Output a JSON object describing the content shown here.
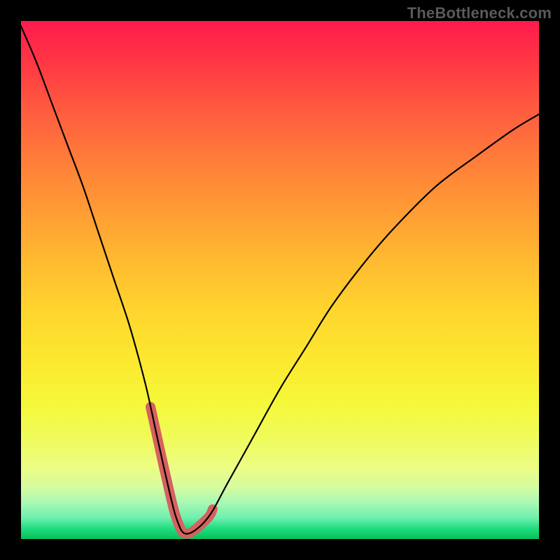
{
  "watermark": "TheBottleneck.com",
  "chart_data": {
    "type": "line",
    "title": "",
    "xlabel": "",
    "ylabel": "",
    "xlim": [
      0,
      100
    ],
    "ylim": [
      0,
      100
    ],
    "background_gradient": {
      "top": "#ff1a4d",
      "bottom": "#06c25a",
      "meaning": "red (high/bottleneck) to green (low/no bottleneck)"
    },
    "series": [
      {
        "name": "bottleneck-curve",
        "x": [
          0,
          3,
          6,
          9,
          12,
          15,
          18,
          21,
          24,
          26,
          28,
          30,
          32,
          36,
          40,
          45,
          50,
          55,
          60,
          66,
          72,
          80,
          88,
          95,
          100
        ],
        "y": [
          99,
          92,
          84,
          76,
          68,
          59,
          50,
          41,
          30,
          21,
          12,
          4,
          1,
          4,
          11,
          20,
          29,
          37,
          45,
          53,
          60,
          68,
          74,
          79,
          82
        ],
        "note": "y is visual height as percent of plot area from bottom; minimum (optimum) around x≈31"
      }
    ],
    "highlight": {
      "name": "optimum-region",
      "x_range": [
        25,
        37
      ],
      "color": "#d6615f",
      "note": "thick marker segment around the valley bottom"
    }
  }
}
